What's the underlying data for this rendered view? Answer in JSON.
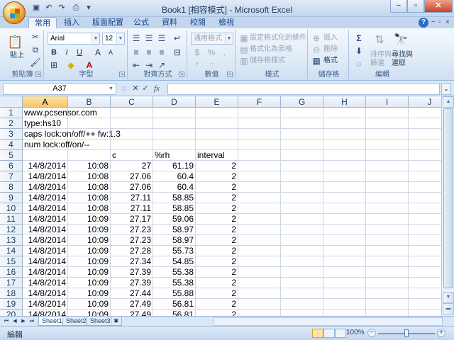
{
  "window": {
    "title": "Book1 [相容模式] - Microsoft Excel"
  },
  "quick_access": [
    {
      "name": "save-icon",
      "glyph": "▣"
    },
    {
      "name": "undo-icon",
      "glyph": "↶"
    },
    {
      "name": "redo-icon",
      "glyph": "↷"
    },
    {
      "name": "print-icon",
      "glyph": "⎙"
    },
    {
      "name": "customize-icon",
      "glyph": "▾"
    }
  ],
  "window_buttons": {
    "minimize": "−",
    "maximize": "▫",
    "close": "✕"
  },
  "tabs": [
    "常用",
    "插入",
    "版面配置",
    "公式",
    "資料",
    "校閱",
    "檢視"
  ],
  "active_tab": "常用",
  "ribbon": {
    "clipboard": {
      "label": "剪貼簿",
      "paste": "貼上"
    },
    "font": {
      "label": "字型",
      "name": "Arial",
      "size": "12",
      "bold": "B",
      "italic": "I",
      "underline": "U",
      "grow": "A",
      "shrink": "A"
    },
    "alignment": {
      "label": "對齊方式"
    },
    "number": {
      "label": "數值",
      "format": "通用格式",
      "percent": "%",
      "comma": ",",
      "currency": "$"
    },
    "styles": {
      "label": "樣式",
      "conditional": "設定格式化的條件",
      "table": "格式化為表格",
      "cell": "儲存格樣式"
    },
    "cells": {
      "label": "儲存格",
      "insert": "插入",
      "delete": "刪除",
      "format": "格式"
    },
    "editing": {
      "label": "編輯",
      "sum": "Σ",
      "sort": "排序與\n篩選",
      "find": "尋找與\n選取"
    }
  },
  "formula_bar": {
    "name_box": "A37",
    "fx": "fx",
    "value": ""
  },
  "columns": [
    "A",
    "B",
    "C",
    "D",
    "E",
    "F",
    "G",
    "H",
    "I",
    "J"
  ],
  "selected_column": "A",
  "rows": [
    {
      "n": "1",
      "A": "www.pcsensor.com",
      "B": "",
      "C": "",
      "D": "",
      "E": ""
    },
    {
      "n": "2",
      "A": "type:hs10",
      "B": "",
      "C": "",
      "D": "",
      "E": ""
    },
    {
      "n": "3",
      "A": "caps lock:on/off/++ fw:1.3",
      "B": "",
      "C": "",
      "D": "",
      "E": ""
    },
    {
      "n": "4",
      "A": "num lock:off/on/--",
      "B": "",
      "C": "",
      "D": "",
      "E": ""
    },
    {
      "n": "5",
      "A": "",
      "B": "",
      "C": "c",
      "D": "%rh",
      "E": "interval"
    },
    {
      "n": "6",
      "A": "14/8/2014",
      "B": "10:08",
      "C": "27",
      "D": "61.19",
      "E": "2"
    },
    {
      "n": "7",
      "A": "14/8/2014",
      "B": "10:08",
      "C": "27.06",
      "D": "60.4",
      "E": "2"
    },
    {
      "n": "8",
      "A": "14/8/2014",
      "B": "10:08",
      "C": "27.06",
      "D": "60.4",
      "E": "2"
    },
    {
      "n": "9",
      "A": "14/8/2014",
      "B": "10:08",
      "C": "27.11",
      "D": "58.85",
      "E": "2"
    },
    {
      "n": "10",
      "A": "14/8/2014",
      "B": "10:08",
      "C": "27.11",
      "D": "58.85",
      "E": "2"
    },
    {
      "n": "11",
      "A": "14/8/2014",
      "B": "10:09",
      "C": "27.17",
      "D": "59.06",
      "E": "2"
    },
    {
      "n": "12",
      "A": "14/8/2014",
      "B": "10:09",
      "C": "27.23",
      "D": "58.97",
      "E": "2"
    },
    {
      "n": "13",
      "A": "14/8/2014",
      "B": "10:09",
      "C": "27.23",
      "D": "58.97",
      "E": "2"
    },
    {
      "n": "14",
      "A": "14/8/2014",
      "B": "10:09",
      "C": "27.28",
      "D": "55.73",
      "E": "2"
    },
    {
      "n": "15",
      "A": "14/8/2014",
      "B": "10:09",
      "C": "27.34",
      "D": "54.85",
      "E": "2"
    },
    {
      "n": "16",
      "A": "14/8/2014",
      "B": "10:09",
      "C": "27.39",
      "D": "55.38",
      "E": "2"
    },
    {
      "n": "17",
      "A": "14/8/2014",
      "B": "10:09",
      "C": "27.39",
      "D": "55.38",
      "E": "2"
    },
    {
      "n": "18",
      "A": "14/8/2014",
      "B": "10:09",
      "C": "27.44",
      "D": "55.88",
      "E": "2"
    },
    {
      "n": "19",
      "A": "14/8/2014",
      "B": "10:09",
      "C": "27.49",
      "D": "56.81",
      "E": "2"
    },
    {
      "n": "20",
      "A": "14/8/2014",
      "B": "10:09",
      "C": "27.49",
      "D": "56.81",
      "E": "2"
    }
  ],
  "sheets": [
    "Sheet1",
    "Sheet2",
    "Sheet3"
  ],
  "active_sheet": "Sheet1",
  "status": {
    "mode": "編輯",
    "zoom": "100%"
  }
}
